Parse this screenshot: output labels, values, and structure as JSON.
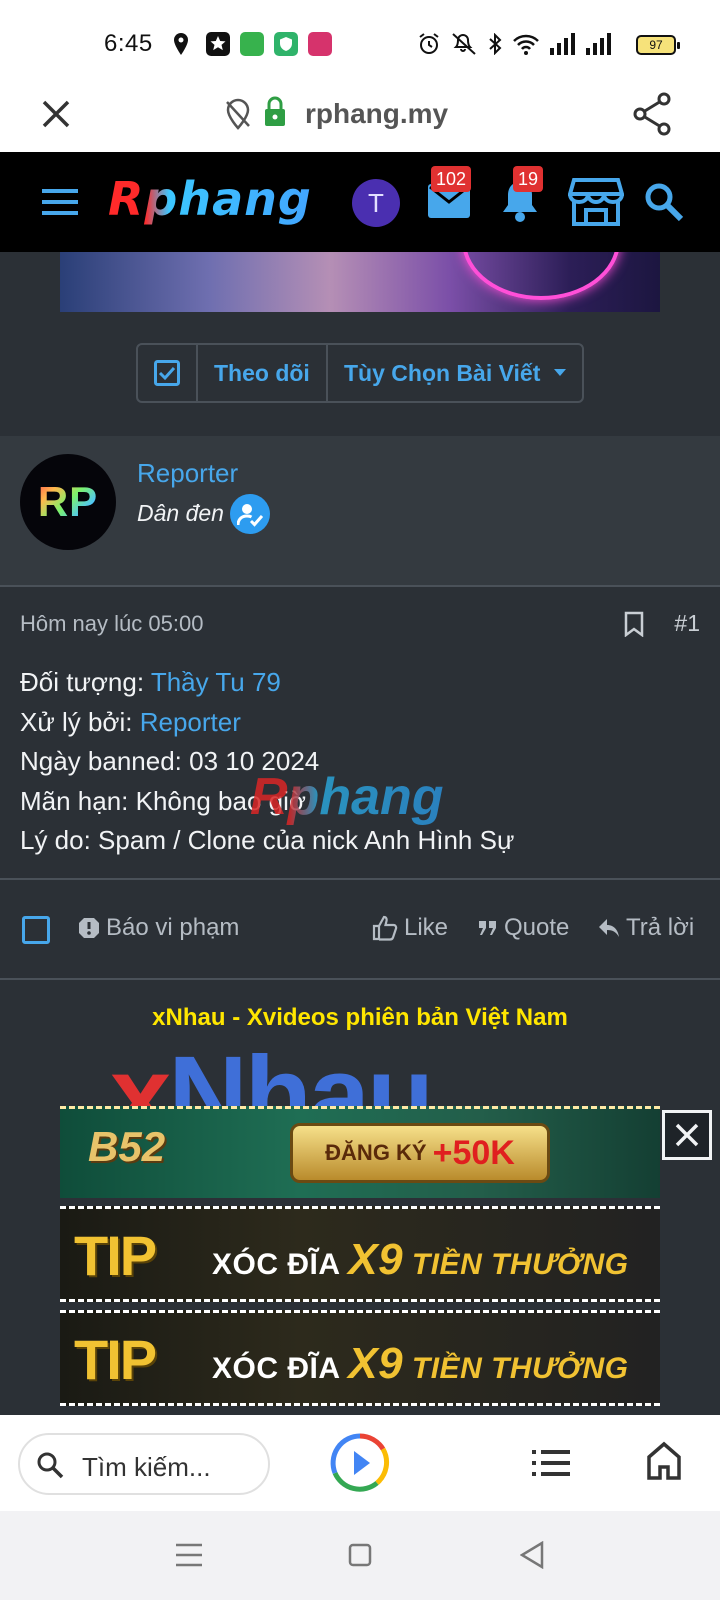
{
  "status_bar": {
    "time": "6:45",
    "battery": "97",
    "icons": [
      "location-icon",
      "app-icon",
      "app-icon",
      "app-icon",
      "app-icon",
      "alarm-icon",
      "mute-icon",
      "bluetooth-icon",
      "wifi-icon",
      "signal-icon",
      "signal-icon",
      "battery-icon"
    ]
  },
  "browser": {
    "url": "rphang.my",
    "search_placeholder": "Tìm kiếm..."
  },
  "header": {
    "logo": "Rphang",
    "user_initial": "T",
    "messages_count": "102",
    "alerts_count": "19"
  },
  "post_tools": {
    "follow_label": "Theo dõi",
    "options_label": "Tùy Chọn Bài Viết"
  },
  "author": {
    "avatar_text": "RP",
    "name": "Reporter",
    "title": "Dân đen"
  },
  "post": {
    "date": "Hôm nay lúc 05:00",
    "number": "#1",
    "subject_label": "Đối tượng: ",
    "subject_value": "Thầy Tu 79",
    "handled_label": "Xử lý bởi: ",
    "handled_value": "Reporter",
    "banned_date": "Ngày banned: 03 10 2024",
    "expiry": "Mãn hạn: Không bao giờ",
    "reason": "Lý do: Spam / Clone của nick Anh Hình Sự",
    "watermark": "Rphang"
  },
  "footer": {
    "report_label": "Báo vi phạm",
    "like_label": "Like",
    "quote_label": "Quote",
    "reply_label": "Trả lời"
  },
  "ads": {
    "title": "xNhau - Xvideos phiên bản Việt Nam",
    "logo_x": "x",
    "logo_rest": "Nhau",
    "b52_logo": "B52",
    "b52_cta_1": "ĐĂNG KÝ",
    "b52_cta_2": "+50K",
    "tip_logo": "TIP",
    "tip_text_1": "XÓC ĐĨA ",
    "tip_x9": "X9",
    "tip_text_2": " TIỀN THƯỞNG"
  },
  "colors": {
    "accent": "#47a7eb",
    "page_bg": "#2b3036",
    "header_bg": "#000000",
    "badge": "#e03131"
  }
}
